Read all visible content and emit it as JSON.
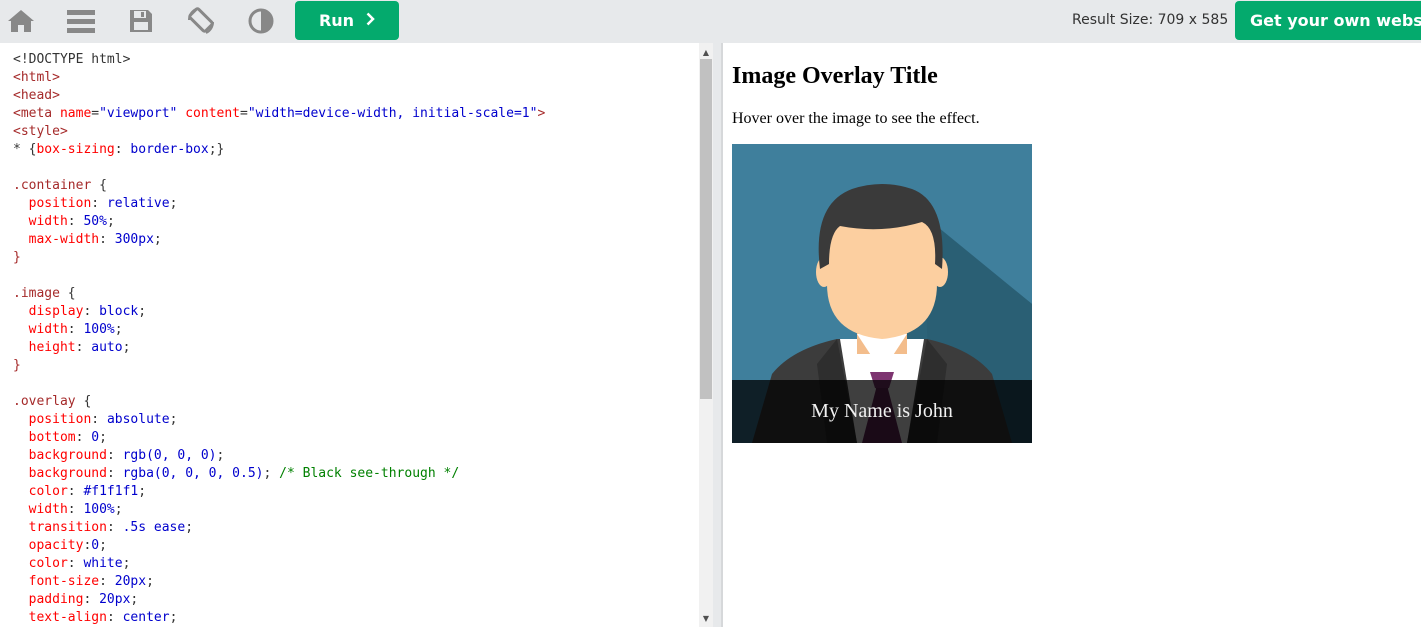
{
  "toolbar": {
    "run_label": "Run",
    "result_size": "Result Size: 709 x 585",
    "get_website_label": "Get your own website"
  },
  "code_lines": [
    [
      [
        "plain",
        "<!DOCTYPE html>"
      ]
    ],
    [
      [
        "tag",
        "<html>"
      ]
    ],
    [
      [
        "tag",
        "<head>"
      ]
    ],
    [
      [
        "tag",
        "<meta "
      ],
      [
        "attr",
        "name"
      ],
      [
        "plain",
        "="
      ],
      [
        "val",
        "\"viewport\""
      ],
      [
        "plain",
        " "
      ],
      [
        "attr",
        "content"
      ],
      [
        "plain",
        "="
      ],
      [
        "val",
        "\"width=device-width, initial-scale=1\""
      ],
      [
        "tag",
        ">"
      ]
    ],
    [
      [
        "tag",
        "<style>"
      ]
    ],
    [
      [
        "plain",
        "* {"
      ],
      [
        "prop",
        "box-sizing"
      ],
      [
        "plain",
        ": "
      ],
      [
        "val",
        "border-box"
      ],
      [
        "plain",
        ";}"
      ]
    ],
    [
      [
        "plain",
        ""
      ]
    ],
    [
      [
        "sel",
        ".container"
      ],
      [
        "plain",
        " {"
      ]
    ],
    [
      [
        "plain",
        "  "
      ],
      [
        "prop",
        "position"
      ],
      [
        "plain",
        ": "
      ],
      [
        "val",
        "relative"
      ],
      [
        "plain",
        ";"
      ]
    ],
    [
      [
        "plain",
        "  "
      ],
      [
        "prop",
        "width"
      ],
      [
        "plain",
        ": "
      ],
      [
        "val",
        "50%"
      ],
      [
        "plain",
        ";"
      ]
    ],
    [
      [
        "plain",
        "  "
      ],
      [
        "prop",
        "max-width"
      ],
      [
        "plain",
        ": "
      ],
      [
        "val",
        "300px"
      ],
      [
        "plain",
        ";"
      ]
    ],
    [
      [
        "sel",
        "}"
      ]
    ],
    [
      [
        "plain",
        ""
      ]
    ],
    [
      [
        "sel",
        ".image"
      ],
      [
        "plain",
        " {"
      ]
    ],
    [
      [
        "plain",
        "  "
      ],
      [
        "prop",
        "display"
      ],
      [
        "plain",
        ": "
      ],
      [
        "val",
        "block"
      ],
      [
        "plain",
        ";"
      ]
    ],
    [
      [
        "plain",
        "  "
      ],
      [
        "prop",
        "width"
      ],
      [
        "plain",
        ": "
      ],
      [
        "val",
        "100%"
      ],
      [
        "plain",
        ";"
      ]
    ],
    [
      [
        "plain",
        "  "
      ],
      [
        "prop",
        "height"
      ],
      [
        "plain",
        ": "
      ],
      [
        "val",
        "auto"
      ],
      [
        "plain",
        ";"
      ]
    ],
    [
      [
        "sel",
        "}"
      ]
    ],
    [
      [
        "plain",
        ""
      ]
    ],
    [
      [
        "sel",
        ".overlay"
      ],
      [
        "plain",
        " {"
      ]
    ],
    [
      [
        "plain",
        "  "
      ],
      [
        "prop",
        "position"
      ],
      [
        "plain",
        ": "
      ],
      [
        "val",
        "absolute"
      ],
      [
        "plain",
        ";"
      ]
    ],
    [
      [
        "plain",
        "  "
      ],
      [
        "prop",
        "bottom"
      ],
      [
        "plain",
        ": "
      ],
      [
        "val",
        "0"
      ],
      [
        "plain",
        ";"
      ]
    ],
    [
      [
        "plain",
        "  "
      ],
      [
        "prop",
        "background"
      ],
      [
        "plain",
        ": "
      ],
      [
        "val",
        "rgb(0, 0, 0)"
      ],
      [
        "plain",
        ";"
      ]
    ],
    [
      [
        "plain",
        "  "
      ],
      [
        "prop",
        "background"
      ],
      [
        "plain",
        ": "
      ],
      [
        "val",
        "rgba(0, 0, 0, 0.5)"
      ],
      [
        "plain",
        "; "
      ],
      [
        "cmt",
        "/* Black see-through */"
      ]
    ],
    [
      [
        "plain",
        "  "
      ],
      [
        "prop",
        "color"
      ],
      [
        "plain",
        ": "
      ],
      [
        "val",
        "#f1f1f1"
      ],
      [
        "plain",
        ";"
      ]
    ],
    [
      [
        "plain",
        "  "
      ],
      [
        "prop",
        "width"
      ],
      [
        "plain",
        ": "
      ],
      [
        "val",
        "100%"
      ],
      [
        "plain",
        ";"
      ]
    ],
    [
      [
        "plain",
        "  "
      ],
      [
        "prop",
        "transition"
      ],
      [
        "plain",
        ": "
      ],
      [
        "val",
        ".5s ease"
      ],
      [
        "plain",
        ";"
      ]
    ],
    [
      [
        "plain",
        "  "
      ],
      [
        "prop",
        "opacity"
      ],
      [
        "plain",
        ":"
      ],
      [
        "val",
        "0"
      ],
      [
        "plain",
        ";"
      ]
    ],
    [
      [
        "plain",
        "  "
      ],
      [
        "prop",
        "color"
      ],
      [
        "plain",
        ": "
      ],
      [
        "val",
        "white"
      ],
      [
        "plain",
        ";"
      ]
    ],
    [
      [
        "plain",
        "  "
      ],
      [
        "prop",
        "font-size"
      ],
      [
        "plain",
        ": "
      ],
      [
        "val",
        "20px"
      ],
      [
        "plain",
        ";"
      ]
    ],
    [
      [
        "plain",
        "  "
      ],
      [
        "prop",
        "padding"
      ],
      [
        "plain",
        ": "
      ],
      [
        "val",
        "20px"
      ],
      [
        "plain",
        ";"
      ]
    ],
    [
      [
        "plain",
        "  "
      ],
      [
        "prop",
        "text-align"
      ],
      [
        "plain",
        ": "
      ],
      [
        "val",
        "center"
      ],
      [
        "plain",
        ";"
      ]
    ]
  ],
  "result": {
    "title": "Image Overlay Title",
    "paragraph": "Hover over the image to see the effect.",
    "overlay_text": "My Name is John"
  },
  "icons": [
    "home-icon",
    "menu-icon",
    "save-icon",
    "rotate-icon",
    "theme-icon",
    "chevron-right-icon"
  ],
  "colors": {
    "accent_green": "#04aa6d",
    "toolbar_bg": "#e7e9eb",
    "avatar_bg": "#3f7f9c",
    "avatar_shadow": "#2c6379",
    "hair": "#3a3a3a",
    "skin": "#fccfa0",
    "suit": "#3c3c3c",
    "tie": "#6b2a5f"
  }
}
